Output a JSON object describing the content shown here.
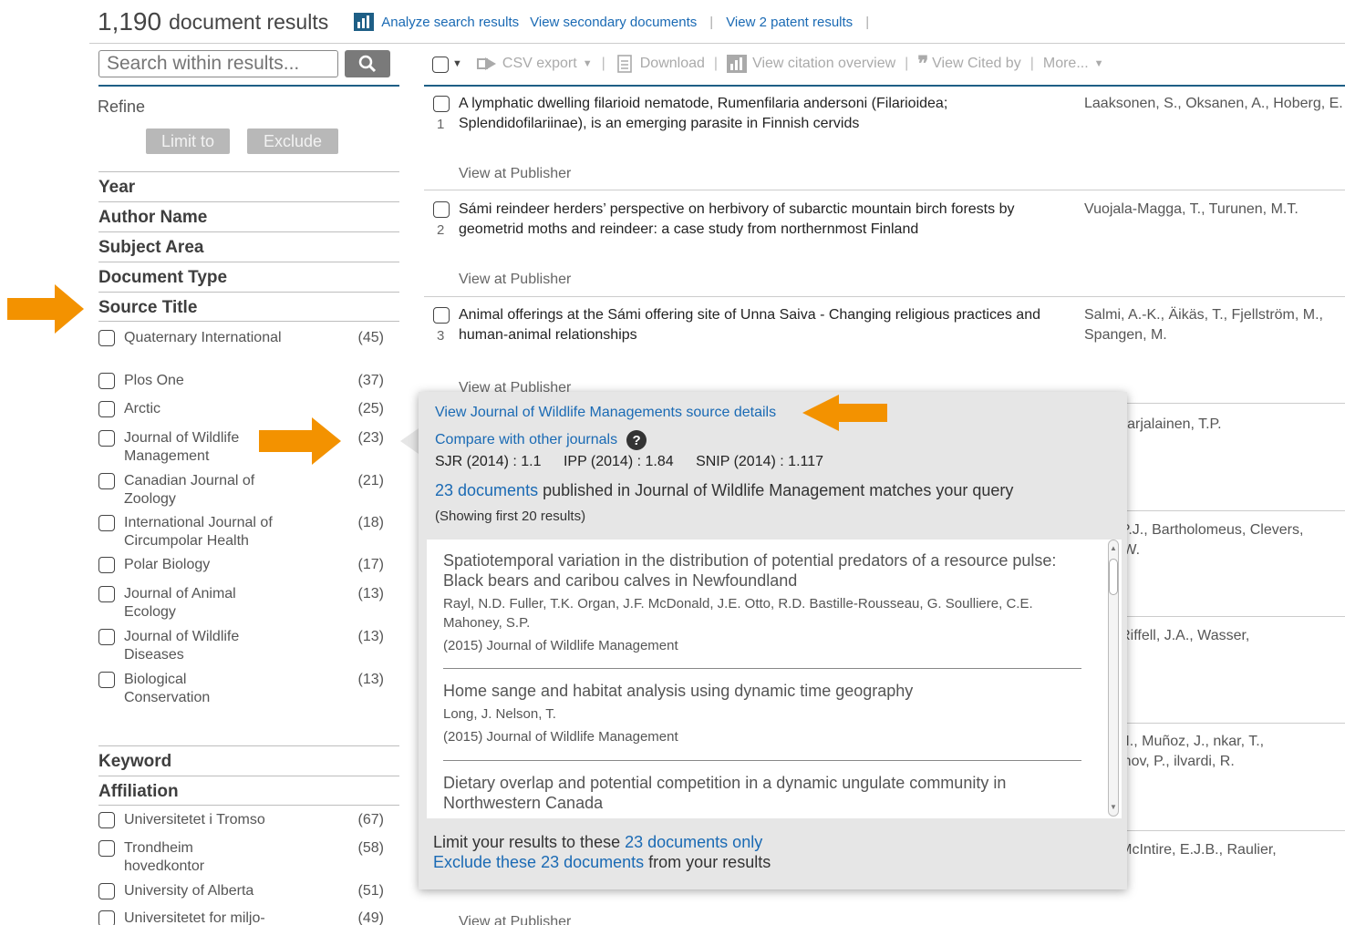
{
  "header": {
    "count": "1,190",
    "count_suffix": "document results",
    "links": [
      "Analyze search results",
      "View secondary documents",
      "View 2 patent results"
    ]
  },
  "sidebar": {
    "search_placeholder": "Search within results...",
    "refine": "Refine",
    "limit_btn": "Limit to",
    "exclude_btn": "Exclude",
    "facets": [
      "Year",
      "Author Name",
      "Subject Area",
      "Document Type",
      "Source Title"
    ],
    "source_titles": [
      {
        "label": "Quaternary International",
        "count": "(45)"
      },
      {
        "label": "Plos One",
        "count": "(37)"
      },
      {
        "label": "Arctic",
        "count": "(25)"
      },
      {
        "label": "Journal of Wildlife Management",
        "count": "(23)"
      },
      {
        "label": "Canadian Journal of Zoology",
        "count": "(21)"
      },
      {
        "label": "International Journal of Circumpolar Health",
        "count": "(18)"
      },
      {
        "label": "Polar Biology",
        "count": "(17)"
      },
      {
        "label": "Journal of Animal Ecology",
        "count": "(13)"
      },
      {
        "label": "Journal of Wildlife Diseases",
        "count": "(13)"
      },
      {
        "label": "Biological Conservation",
        "count": "(13)"
      }
    ],
    "facets2": [
      "Keyword",
      "Affiliation"
    ],
    "affiliations": [
      {
        "label": "Universitetet i Tromso",
        "count": "(67)"
      },
      {
        "label": "Trondheim hovedkontor",
        "count": "(58)"
      },
      {
        "label": "University of Alberta",
        "count": "(51)"
      },
      {
        "label": "Universitetet for miljo-",
        "count": "(49)"
      }
    ]
  },
  "toolbar": {
    "csv": "CSV export",
    "download": "Download",
    "citation": "View citation overview",
    "cited_by": "View Cited by",
    "more": "More..."
  },
  "results": [
    {
      "num": "1",
      "title": "A lymphatic dwelling filarioid nematode, Rumenfilaria andersoni (Filarioidea; Splendidofilariinae), is an emerging parasite in Finnish cervids",
      "authors": "Laaksonen, S., Oksanen, A., Hoberg, E.",
      "pub": "View at Publisher"
    },
    {
      "num": "2",
      "title": "Sámi reindeer herders’ perspective on herbivory of subarctic mountain birch forests by geometrid moths and reindeer: a case study from northernmost Finland",
      "authors": "Vuojala-Magga, T., Turunen, M.T.",
      "pub": "View at Publisher"
    },
    {
      "num": "3",
      "title": "Animal offerings at the Sámi offering site of Unna Saiva - Changing religious practices and human-animal relationships",
      "authors": "Salmi, A.-K., Äikäs, T., Fjellström, M., Spangen, M.",
      "pub": "View at Publisher"
    }
  ],
  "partial_authors": [
    "i, S., Karjalainen, T.P.",
    "en, P.P.J., Bartholomeus, Clevers, J.G.P.W.",
    ", J.I., Riffell, J.A., Wasser,",
    "a, J.A.I., Muñoz, J., nkar, T., Romanov, P., ilvardi, R.",
    "n, J., McIntire, E.J.B., Raulier,"
  ],
  "bottom_pub": "View at Publisher",
  "popup": {
    "source_link": "View Journal of Wildlife Managements source details",
    "compare_link": "Compare with other journals",
    "help": "?",
    "sjr": "SJR (2014) : 1.1",
    "ipp": "IPP (2014) : 1.84",
    "snip": "SNIP (2014) : 1.117",
    "docs_link": "23 documents",
    "docs_rest": "published in Journal of Wildlife Management matches your query",
    "showing": "(Showing first 20 results)",
    "items": [
      {
        "title": "Spatiotemporal variation in the distribution of potential predators of a resource pulse: Black bears and caribou calves in Newfoundland",
        "authors": "Rayl, N.D. Fuller, T.K. Organ, J.F. McDonald, J.E. Otto, R.D. Bastille-Rousseau, G. Soulliere, C.E. Mahoney, S.P.",
        "source": "(2015) Journal of Wildlife Management"
      },
      {
        "title": "Home sange and habitat analysis using dynamic time geography",
        "authors": "Long, J. Nelson, T.",
        "source": "(2015) Journal of Wildlife Management"
      },
      {
        "title": "Dietary overlap and potential competition in a dynamic ungulate community in Northwestern Canada",
        "authors": "",
        "source": ""
      }
    ],
    "foot_limit_pre": "Limit your results to these",
    "foot_limit_link": "23 documents only",
    "foot_excl_link": "Exclude these 23 documents",
    "foot_excl_post": "from your results"
  },
  "colors": {
    "accent_arrow": "#f39200",
    "link": "#1a6ab4",
    "rule": "#1e5f86"
  }
}
